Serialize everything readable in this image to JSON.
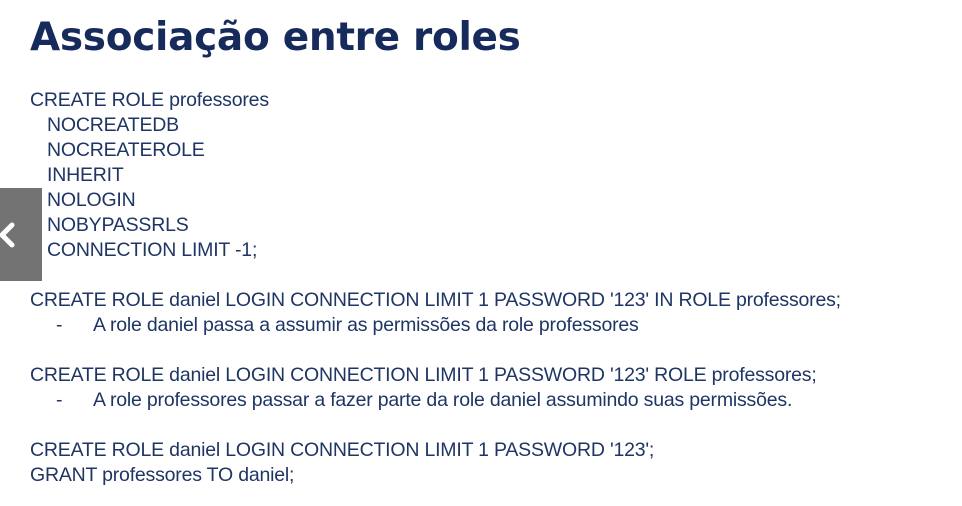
{
  "slide": {
    "title": "Associação entre roles",
    "block1": {
      "create": "CREATE ROLE professores",
      "options": [
        "NOCREATEDB",
        "NOCREATEROLE",
        "INHERIT",
        "NOLOGIN",
        "NOBYPASSRLS",
        "CONNECTION LIMIT -1;"
      ]
    },
    "block2": {
      "statement": "CREATE ROLE daniel LOGIN CONNECTION LIMIT 1 PASSWORD '123' IN ROLE professores;",
      "dash": "-",
      "note": "A role daniel passa a assumir as permissões da role professores"
    },
    "block3": {
      "statement": "CREATE ROLE daniel LOGIN CONNECTION LIMIT 1 PASSWORD '123' ROLE professores;",
      "dash": "-",
      "note": "A role professores passar a fazer parte da role daniel assumindo suas permissões."
    },
    "block4": {
      "statement": "CREATE ROLE daniel LOGIN CONNECTION LIMIT 1 PASSWORD '123';",
      "grant": "GRANT professores TO daniel;"
    }
  },
  "nav": {
    "prev_icon": "chevron-left-icon",
    "button_color": "#737373"
  },
  "colors": {
    "title": "#172a5c",
    "text": "#1f3564",
    "background": "#ffffff"
  }
}
